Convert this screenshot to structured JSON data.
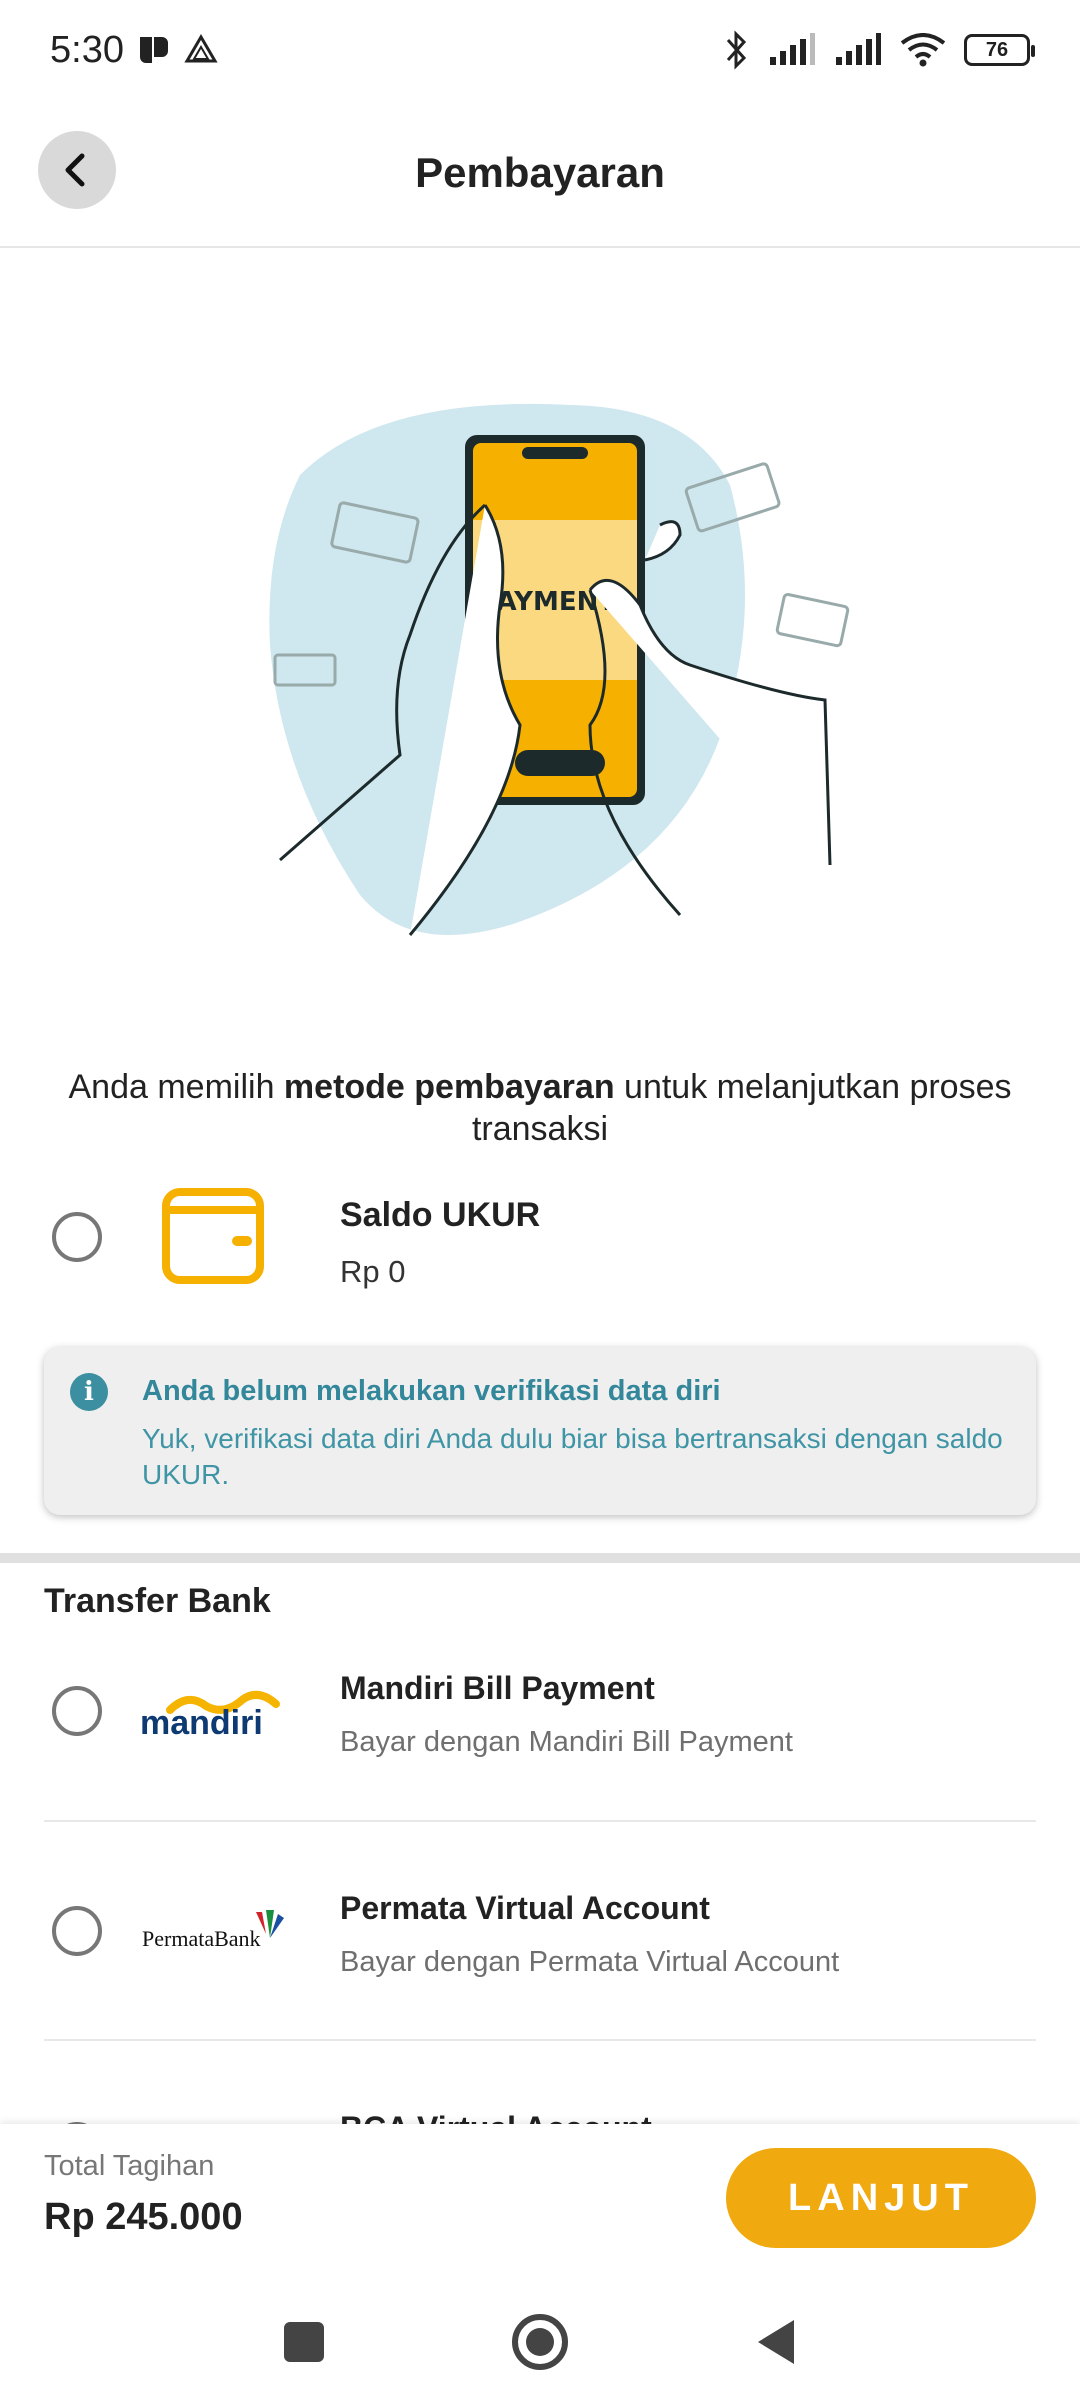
{
  "status_bar": {
    "time": "5:30",
    "battery": "76",
    "icons": [
      "bluetooth-icon",
      "signal-icon",
      "signal-icon",
      "wifi-icon"
    ]
  },
  "header": {
    "title": "Pembayaran",
    "back_icon": "chevron-left-icon"
  },
  "illustration": {
    "phone_text": "PAYMENT"
  },
  "intro": {
    "prefix": "Anda memilih ",
    "bold": "metode pembayaran",
    "suffix": " untuk melanjutkan proses transaksi"
  },
  "wallet": {
    "title": "Saldo UKUR",
    "balance": "Rp 0",
    "icon": "wallet-icon"
  },
  "alert": {
    "title": "Anda belum melakukan verifikasi data diri",
    "body": "Yuk, verifikasi data diri Anda dulu biar bisa bertransaksi dengan saldo UKUR."
  },
  "transfer_bank": {
    "section_title": "Transfer Bank",
    "methods": [
      {
        "logo_text": "mandiri",
        "title": "Mandiri Bill Payment",
        "subtitle": "Bayar dengan Mandiri Bill Payment"
      },
      {
        "logo_text": "PermataBank",
        "title": "Permata Virtual Account",
        "subtitle": "Bayar dengan Permata Virtual Account"
      },
      {
        "logo_text": "",
        "title": "BCA Virtual Account",
        "subtitle": ""
      }
    ]
  },
  "footer": {
    "total_label": "Total Tagihan",
    "total_value": "Rp 245.000",
    "continue_label": "LANJUT"
  },
  "colors": {
    "accent": "#f0a90f",
    "info": "#33879a"
  }
}
